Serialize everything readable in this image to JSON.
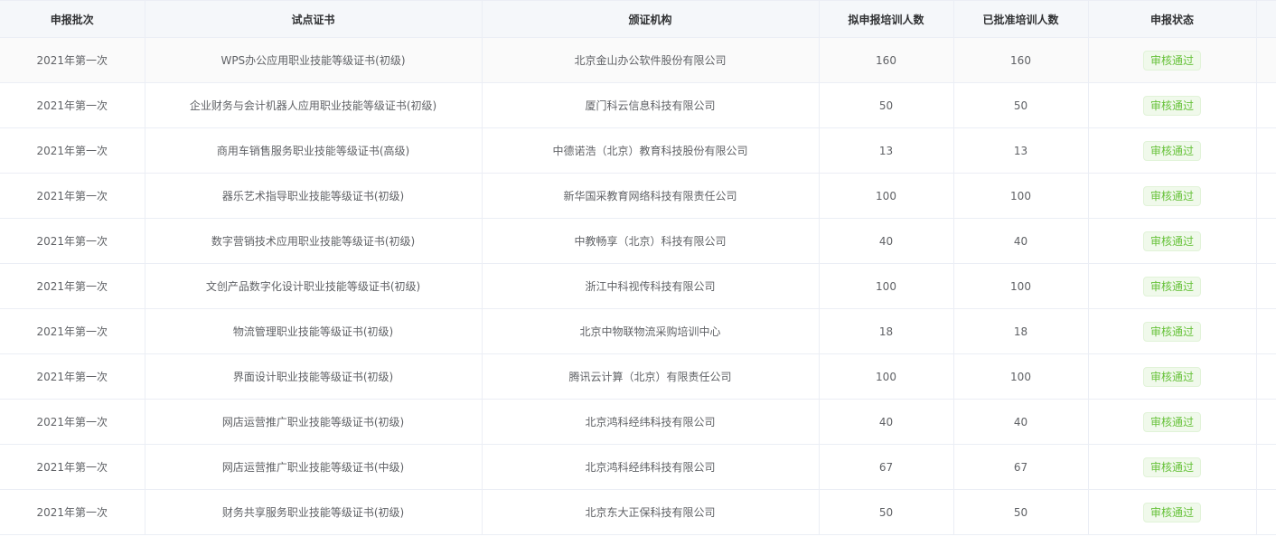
{
  "table": {
    "headers": [
      "申报批次",
      "试点证书",
      "颁证机构",
      "拟申报培训人数",
      "已批准培训人数",
      "申报状态"
    ],
    "rows": [
      {
        "batch": "2021年第一次",
        "certificate": "WPS办公应用职业技能等级证书(初级)",
        "issuer": "北京金山办公软件股份有限公司",
        "planned": "160",
        "approved": "160",
        "status": "审核通过"
      },
      {
        "batch": "2021年第一次",
        "certificate": "企业财务与会计机器人应用职业技能等级证书(初级)",
        "issuer": "厦门科云信息科技有限公司",
        "planned": "50",
        "approved": "50",
        "status": "审核通过"
      },
      {
        "batch": "2021年第一次",
        "certificate": "商用车销售服务职业技能等级证书(高级)",
        "issuer": "中德诺浩（北京）教育科技股份有限公司",
        "planned": "13",
        "approved": "13",
        "status": "审核通过"
      },
      {
        "batch": "2021年第一次",
        "certificate": "器乐艺术指导职业技能等级证书(初级)",
        "issuer": "新华国采教育网络科技有限责任公司",
        "planned": "100",
        "approved": "100",
        "status": "审核通过"
      },
      {
        "batch": "2021年第一次",
        "certificate": "数字营销技术应用职业技能等级证书(初级)",
        "issuer": "中教畅享（北京）科技有限公司",
        "planned": "40",
        "approved": "40",
        "status": "审核通过"
      },
      {
        "batch": "2021年第一次",
        "certificate": "文创产品数字化设计职业技能等级证书(初级)",
        "issuer": "浙江中科视传科技有限公司",
        "planned": "100",
        "approved": "100",
        "status": "审核通过"
      },
      {
        "batch": "2021年第一次",
        "certificate": "物流管理职业技能等级证书(初级)",
        "issuer": "北京中物联物流采购培训中心",
        "planned": "18",
        "approved": "18",
        "status": "审核通过"
      },
      {
        "batch": "2021年第一次",
        "certificate": "界面设计职业技能等级证书(初级)",
        "issuer": "腾讯云计算（北京）有限责任公司",
        "planned": "100",
        "approved": "100",
        "status": "审核通过"
      },
      {
        "batch": "2021年第一次",
        "certificate": "网店运营推广职业技能等级证书(初级)",
        "issuer": "北京鸿科经纬科技有限公司",
        "planned": "40",
        "approved": "40",
        "status": "审核通过"
      },
      {
        "batch": "2021年第一次",
        "certificate": "网店运营推广职业技能等级证书(中级)",
        "issuer": "北京鸿科经纬科技有限公司",
        "planned": "67",
        "approved": "67",
        "status": "审核通过"
      },
      {
        "batch": "2021年第一次",
        "certificate": "财务共享服务职业技能等级证书(初级)",
        "issuer": "北京东大正保科技有限公司",
        "planned": "50",
        "approved": "50",
        "status": "审核通过"
      }
    ]
  }
}
